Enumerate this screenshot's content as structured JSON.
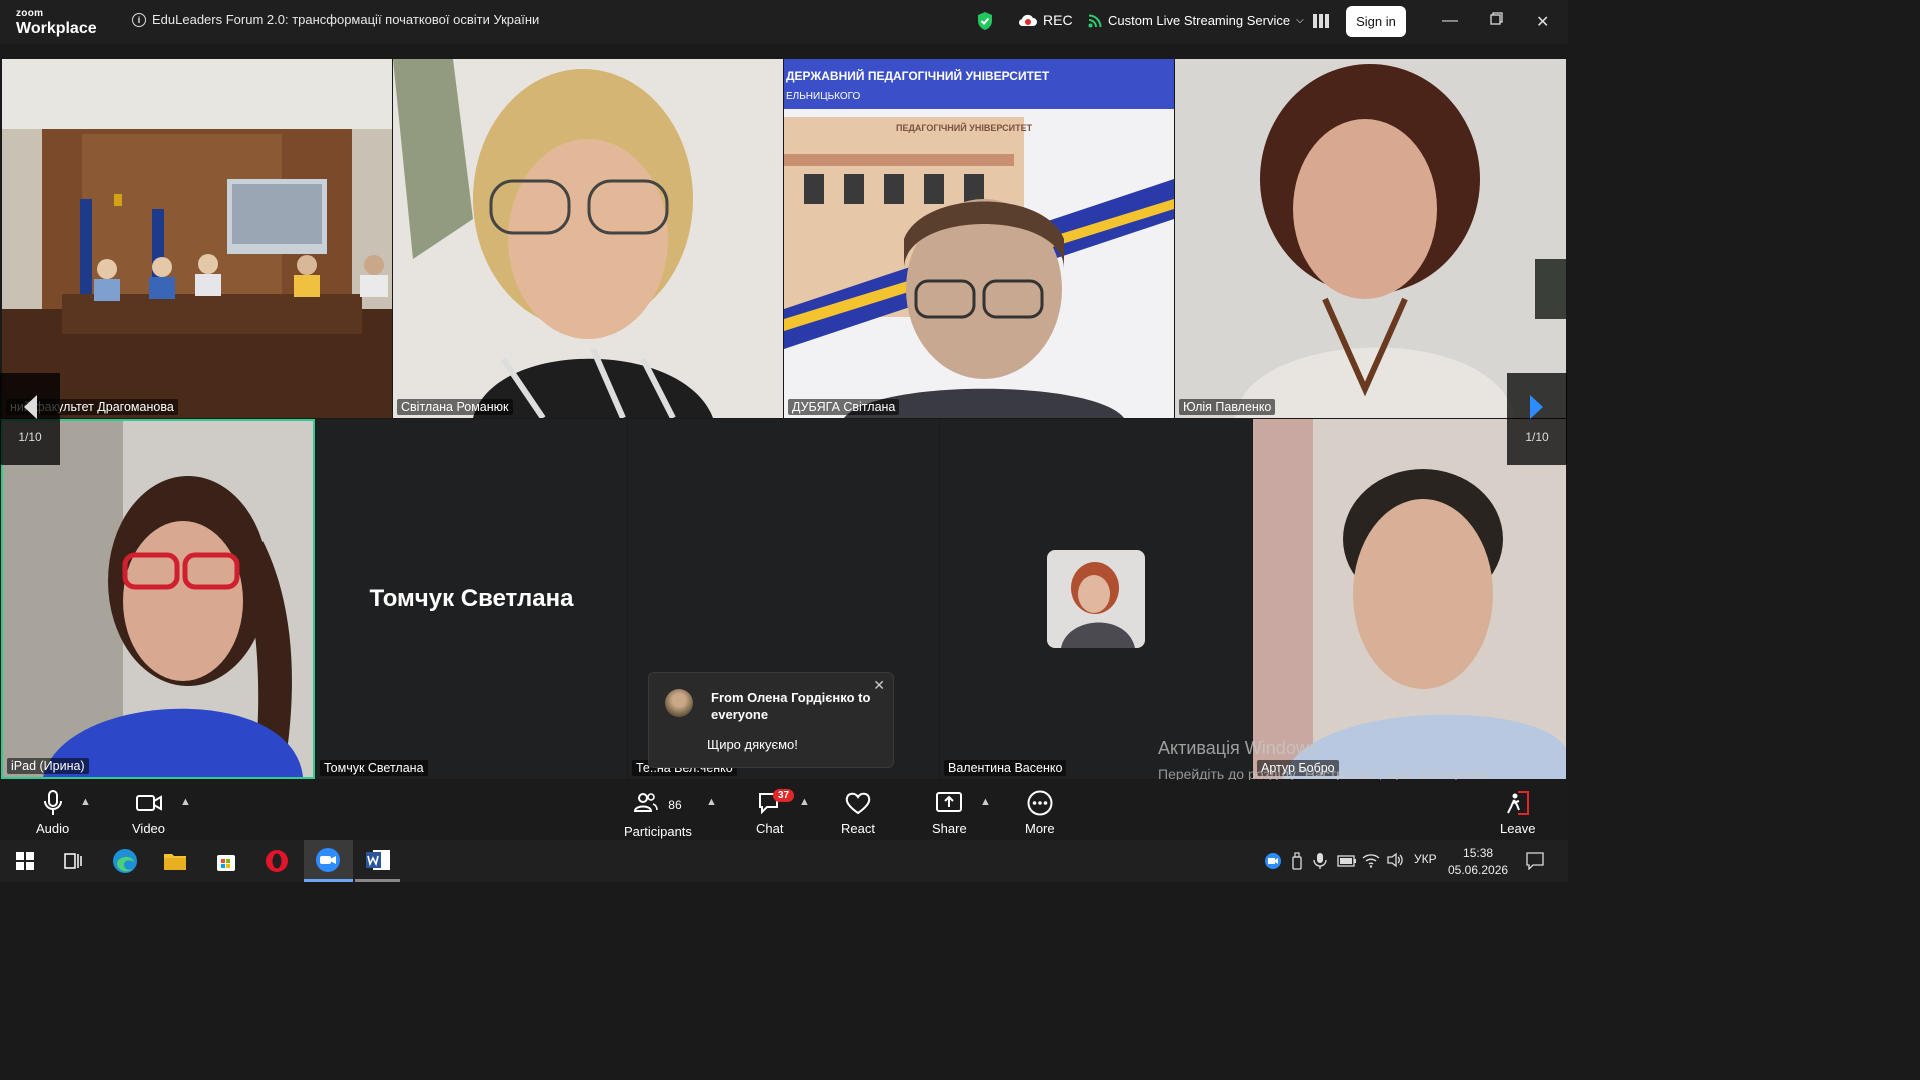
{
  "app": {
    "logo_top": "zoom",
    "logo_bottom": "Workplace"
  },
  "meeting": {
    "title": "EduLeaders Forum 2.0: трансформації початкової освіти України"
  },
  "header": {
    "rec_label": "REC",
    "stream_label": "Custom Live Streaming Service",
    "signin_label": "Sign in"
  },
  "pagination": {
    "left": "1/10",
    "right": "1/10"
  },
  "tiles": [
    {
      "name": "ний факультет Драгоманова"
    },
    {
      "name": "Світлана Романюк"
    },
    {
      "name": "ДУБЯГА Світлана"
    },
    {
      "name": "Юлія Павленко"
    },
    {
      "name": "iPad (Ирина)"
    },
    {
      "name": "Томчук Светлана",
      "big": "Томчук Светлана"
    },
    {
      "name": "Те..на Вел.ченко"
    },
    {
      "name": "Валентина Васенко"
    },
    {
      "name": "Артур Бобро"
    }
  ],
  "banner": {
    "line1": "ДЕРЖАВНИЙ ПЕДАГОГІЧНИЙ УНІВЕРСИТЕТ",
    "line2": "ЕЛЬНИЦЬКОГО",
    "building": "ПЕДАГОГІЧНИЙ УНІВЕРСИТЕТ"
  },
  "chat_popup": {
    "from": "From Олена Гордієнко to everyone",
    "message": "Щиро дякуємо!"
  },
  "watermark": {
    "title": "Активація Windows",
    "body": "Перейдіть до розділу \"Настройки\", щоб активувати Windows."
  },
  "toolbar": {
    "audio": "Audio",
    "video": "Video",
    "participants": "Participants",
    "participants_count": "86",
    "chat": "Chat",
    "chat_badge": "37",
    "react": "React",
    "share": "Share",
    "more": "More",
    "leave": "Leave"
  },
  "taskbar": {
    "lang": "УКР",
    "time": "15:38",
    "date": "05.06.2026"
  },
  "colors": {
    "accent_green": "#2ecc8e",
    "brand_blue": "#2d8cff",
    "rec_red": "#e02828"
  }
}
